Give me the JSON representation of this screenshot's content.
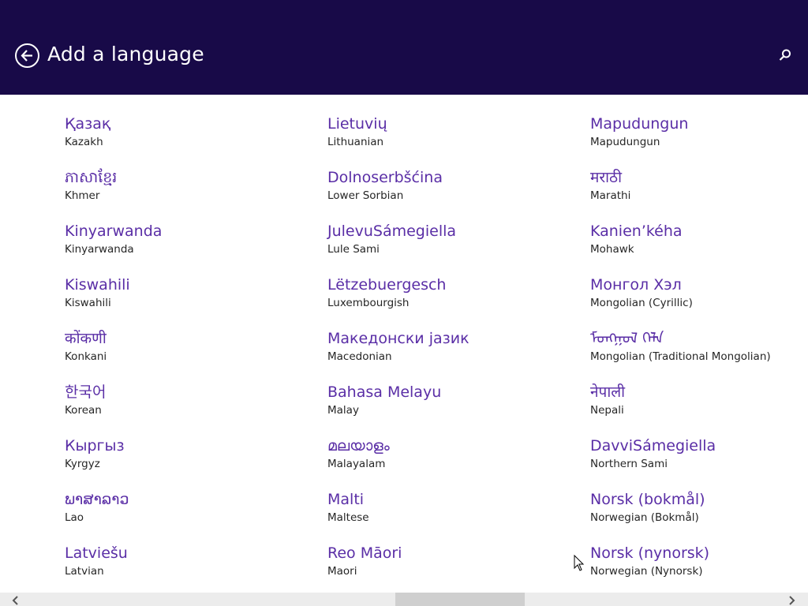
{
  "header": {
    "title": "Add a language",
    "back_icon": "back-arrow-circle-icon",
    "search_icon": "search-icon",
    "background": "#180a48"
  },
  "colors": {
    "native_text": "#5a2ea6",
    "english_text": "#262626"
  },
  "columns": [
    [
      {
        "native": "Қазақ",
        "english": "Kazakh"
      },
      {
        "native": "ភាសាខ្មែរ",
        "english": "Khmer"
      },
      {
        "native": "Kinyarwanda",
        "english": "Kinyarwanda"
      },
      {
        "native": "Kiswahili",
        "english": "Kiswahili"
      },
      {
        "native": "कोंकणी",
        "english": "Konkani"
      },
      {
        "native": "한국어",
        "english": "Korean"
      },
      {
        "native": "Кыргыз",
        "english": "Kyrgyz"
      },
      {
        "native": "ພາສາລາວ",
        "english": "Lao"
      },
      {
        "native": "Latviešu",
        "english": "Latvian"
      }
    ],
    [
      {
        "native": "Lietuvių",
        "english": "Lithuanian"
      },
      {
        "native": "Dolnoserbšćina",
        "english": "Lower Sorbian"
      },
      {
        "native": "JulevuSámegiella",
        "english": "Lule Sami"
      },
      {
        "native": "Lëtzebuergesch",
        "english": "Luxembourgish"
      },
      {
        "native": "Македонски јазик",
        "english": "Macedonian"
      },
      {
        "native": "Bahasa Melayu",
        "english": "Malay"
      },
      {
        "native": "മലയാളം",
        "english": "Malayalam"
      },
      {
        "native": "Malti",
        "english": "Maltese"
      },
      {
        "native": "Reo Māori",
        "english": "Maori"
      }
    ],
    [
      {
        "native": "Mapudungun",
        "english": "Mapudungun"
      },
      {
        "native": "मराठी",
        "english": "Marathi"
      },
      {
        "native": "Kanien’kéha",
        "english": "Mohawk"
      },
      {
        "native": "Монгол Хэл",
        "english": "Mongolian (Cyrillic)"
      },
      {
        "native": "ᠮᠣᠩᠭᠣᠯ ᠬᠡᠯᠡ",
        "english": "Mongolian (Traditional Mongolian)"
      },
      {
        "native": "नेपाली",
        "english": "Nepali"
      },
      {
        "native": "DavviSámegiella",
        "english": "Northern Sami"
      },
      {
        "native": "Norsk (bokmål)",
        "english": "Norwegian (Bokmål)"
      },
      {
        "native": "Norsk (nynorsk)",
        "english": "Norwegian (Nynorsk)"
      }
    ]
  ],
  "scrollbar": {
    "left_icon": "chevron-left-icon",
    "right_icon": "chevron-right-icon"
  }
}
